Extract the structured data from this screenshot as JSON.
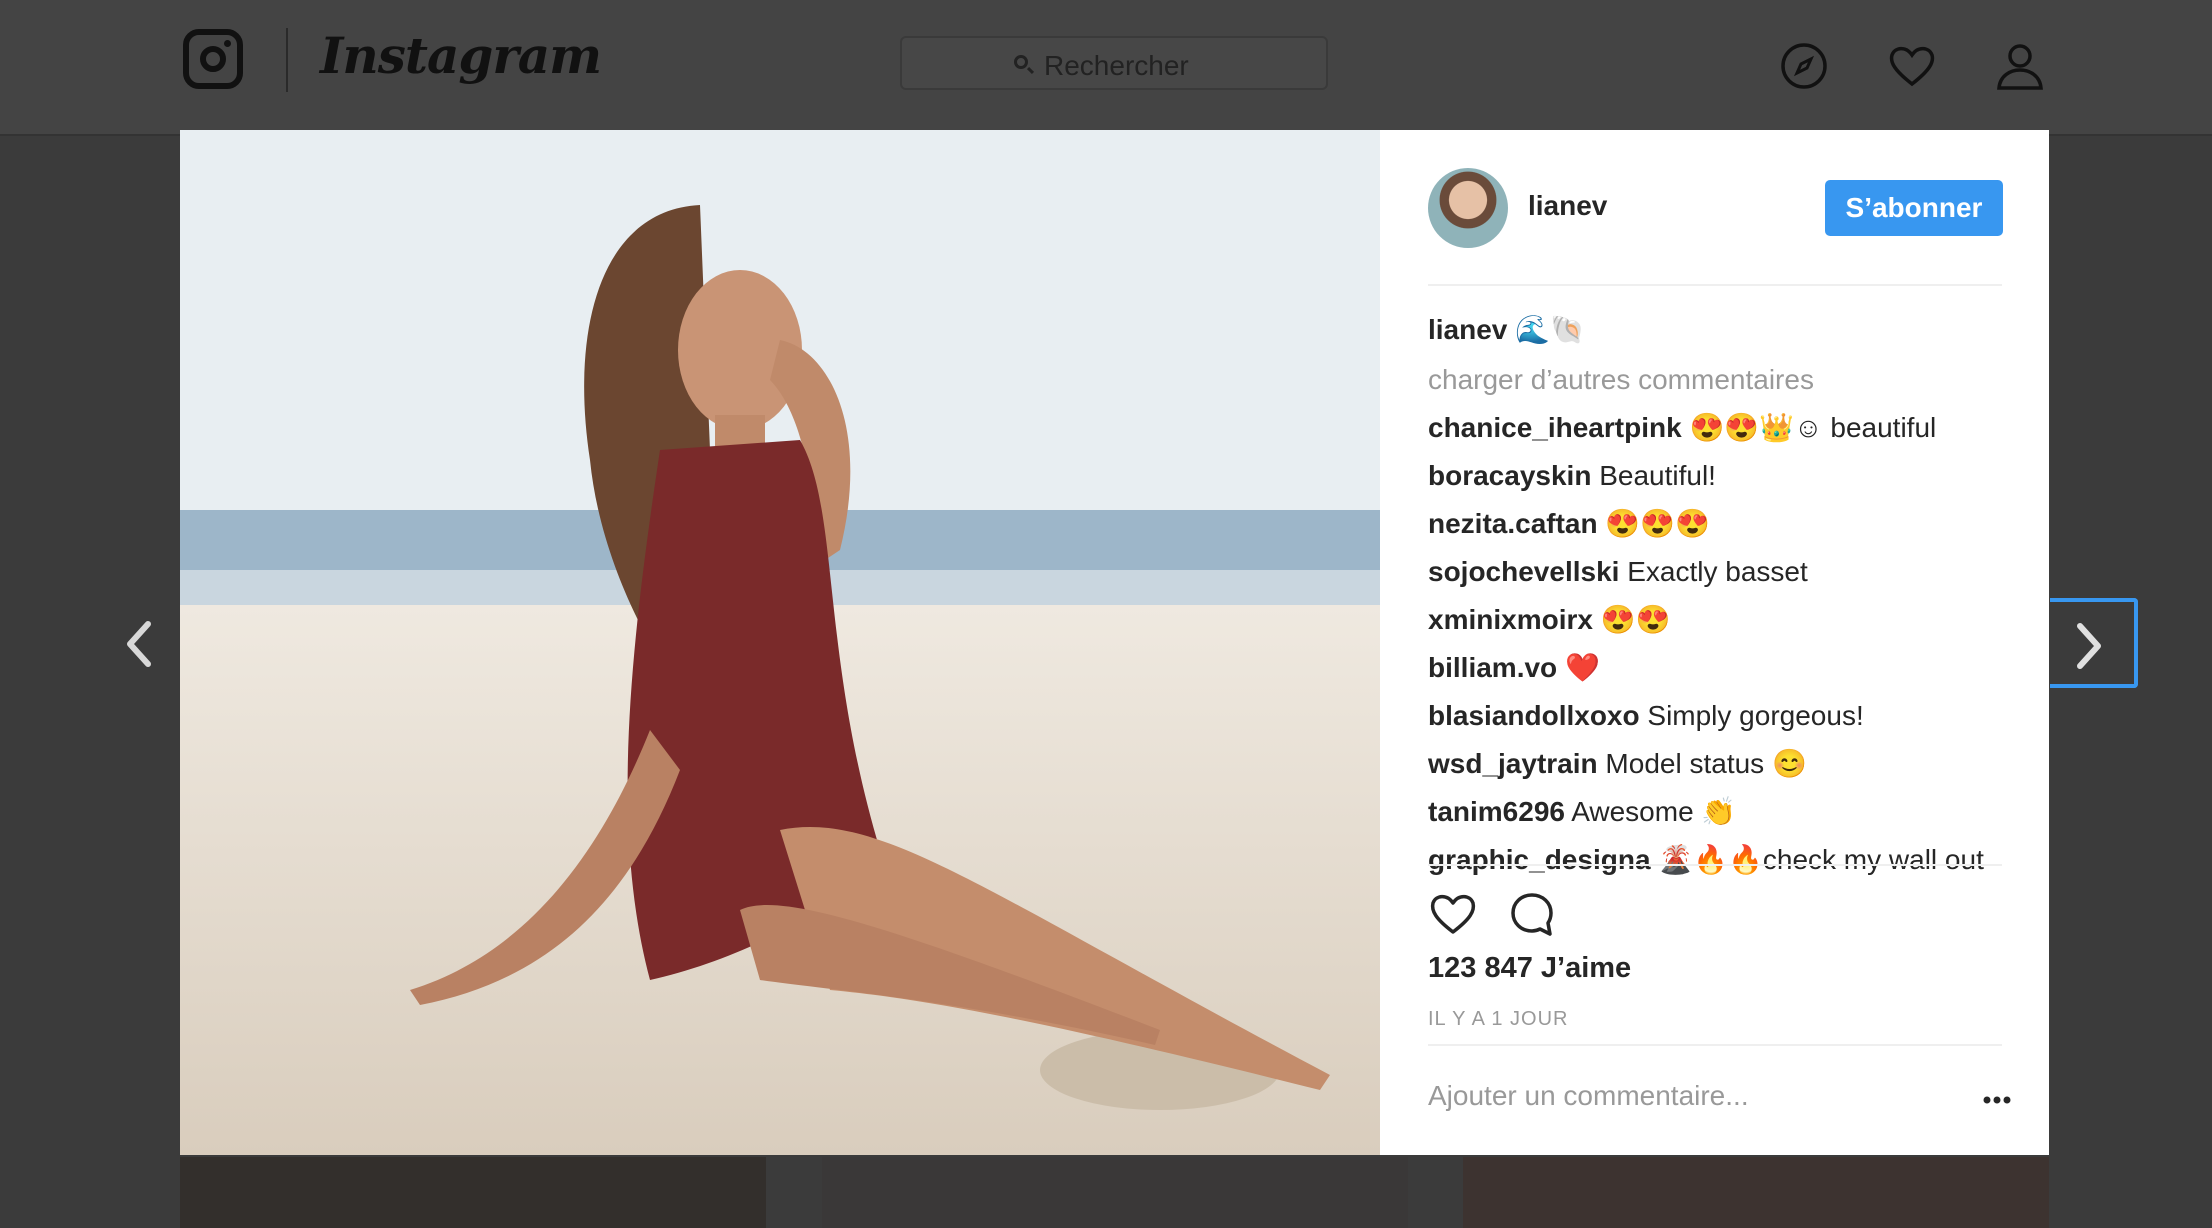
{
  "header": {
    "app_name": "Instagram",
    "search_placeholder": "Rechercher"
  },
  "post": {
    "username": "lianev",
    "follow_label": "S’abonner",
    "caption": {
      "user": "lianev",
      "text": "🌊🐚"
    },
    "load_more_label": "charger d’autres commentaires",
    "comments": [
      {
        "user": "chanice_iheartpink",
        "text": "😍😍👑☺ beautiful"
      },
      {
        "user": "boracayskin",
        "text": "Beautiful!"
      },
      {
        "user": "nezita.caftan",
        "text": "😍😍😍"
      },
      {
        "user": "sojochevellski",
        "text": "Exactly basset"
      },
      {
        "user": "xminixmoirx",
        "text": "😍😍"
      },
      {
        "user": "billiam.vo",
        "text": "❤️"
      },
      {
        "user": "blasiandollxoxo",
        "text": "Simply gorgeous!"
      },
      {
        "user": "wsd_jaytrain",
        "text": "Model status 😊"
      },
      {
        "user": "tanim6296",
        "text": "Awesome 👏"
      },
      {
        "user": "graphic_designa",
        "text": "🌋🔥🔥check my wall out"
      }
    ],
    "likes": "123 847 J’aime",
    "timestamp": "IL Y A 1 JOUR",
    "add_comment_placeholder": "Ajouter un commentaire..."
  },
  "colors": {
    "accent": "#3897f0",
    "overlay": "#3b3b3b",
    "text_primary": "#262626",
    "text_secondary": "#999999"
  },
  "icons": [
    "instagram-camera-icon",
    "search-icon",
    "compass-icon",
    "heart-icon",
    "user-icon",
    "like-icon",
    "comment-icon",
    "more-options-icon",
    "previous-arrow-icon",
    "next-arrow-icon"
  ]
}
